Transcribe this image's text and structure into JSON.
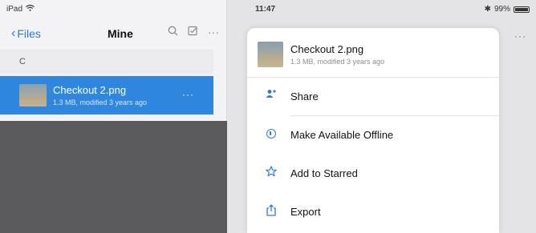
{
  "status_bar": {
    "device": "iPad",
    "time": "11:47",
    "battery": "99%"
  },
  "nav": {
    "back_label": "Files",
    "title": "Mine"
  },
  "section": {
    "header": "C"
  },
  "file": {
    "name": "Checkout 2.png",
    "meta": "1.3 MB, modified 3 years ago"
  },
  "sheet": {
    "title": "Checkout 2.png",
    "subtitle": "1.3 MB, modified 3 years ago",
    "items": [
      {
        "label": "Share",
        "icon": "share-person-icon"
      },
      {
        "label": "Make Available Offline",
        "icon": "offline-icon"
      },
      {
        "label": "Add to Starred",
        "icon": "star-icon"
      },
      {
        "label": "Export",
        "icon": "export-icon"
      }
    ]
  },
  "colors": {
    "accent": "#2c7ad6",
    "selection": "#2f86de"
  }
}
